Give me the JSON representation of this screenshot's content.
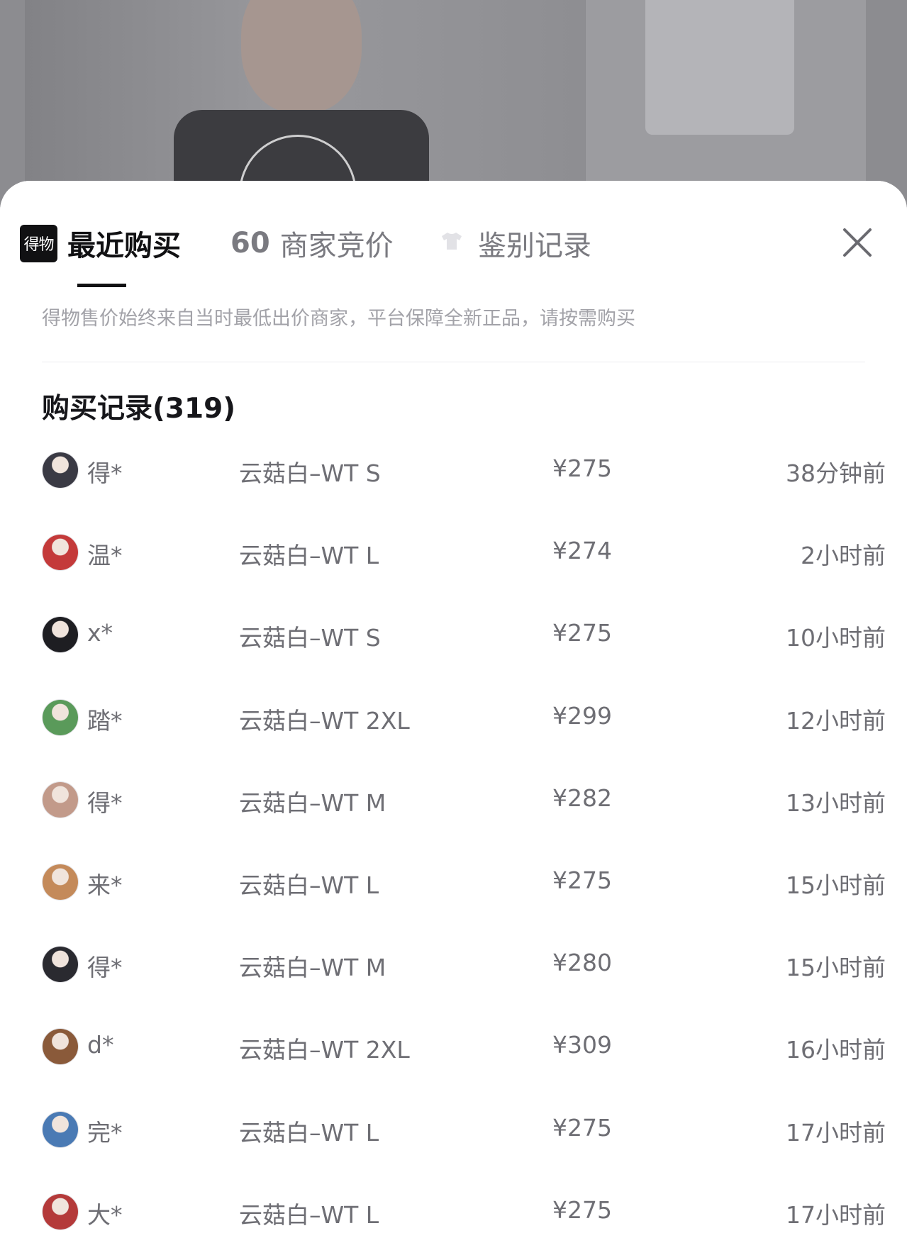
{
  "tabs": {
    "recent": {
      "logo_text": "得物",
      "label": "最近购买"
    },
    "bids": {
      "count": "60",
      "label": "商家竞价"
    },
    "authentication": {
      "label": "鉴别记录",
      "icon": "tshirt-icon"
    },
    "close_icon": "close-icon"
  },
  "notice": "得物售价始终来自当时最低出价商家，平台保障全新正品，请按需购买",
  "records": {
    "title": "购买记录(319)",
    "rows": [
      {
        "user": "得*",
        "spec": "云菇白–WT S",
        "price": "¥275",
        "time": "38分钟前",
        "avatar_color": "#3a3a44"
      },
      {
        "user": "温*",
        "spec": "云菇白–WT L",
        "price": "¥274",
        "time": "2小时前",
        "avatar_color": "#c43a3a"
      },
      {
        "user": "x*",
        "spec": "云菇白–WT S",
        "price": "¥275",
        "time": "10小时前",
        "avatar_color": "#1e1e22"
      },
      {
        "user": "踏*",
        "spec": "云菇白–WT 2XL",
        "price": "¥299",
        "time": "12小时前",
        "avatar_color": "#5a9a5a"
      },
      {
        "user": "得*",
        "spec": "云菇白–WT M",
        "price": "¥282",
        "time": "13小时前",
        "avatar_color": "#c29a8a"
      },
      {
        "user": "来*",
        "spec": "云菇白–WT L",
        "price": "¥275",
        "time": "15小时前",
        "avatar_color": "#c48a5a"
      },
      {
        "user": "得*",
        "spec": "云菇白–WT M",
        "price": "¥280",
        "time": "15小时前",
        "avatar_color": "#2a2a30"
      },
      {
        "user": "d*",
        "spec": "云菇白–WT 2XL",
        "price": "¥309",
        "time": "16小时前",
        "avatar_color": "#8a5a3a"
      },
      {
        "user": "完*",
        "spec": "云菇白–WT L",
        "price": "¥275",
        "time": "17小时前",
        "avatar_color": "#4a7ab4"
      },
      {
        "user": "大*",
        "spec": "云菇白–WT L",
        "price": "¥275",
        "time": "17小时前",
        "avatar_color": "#b43a3a"
      }
    ]
  }
}
